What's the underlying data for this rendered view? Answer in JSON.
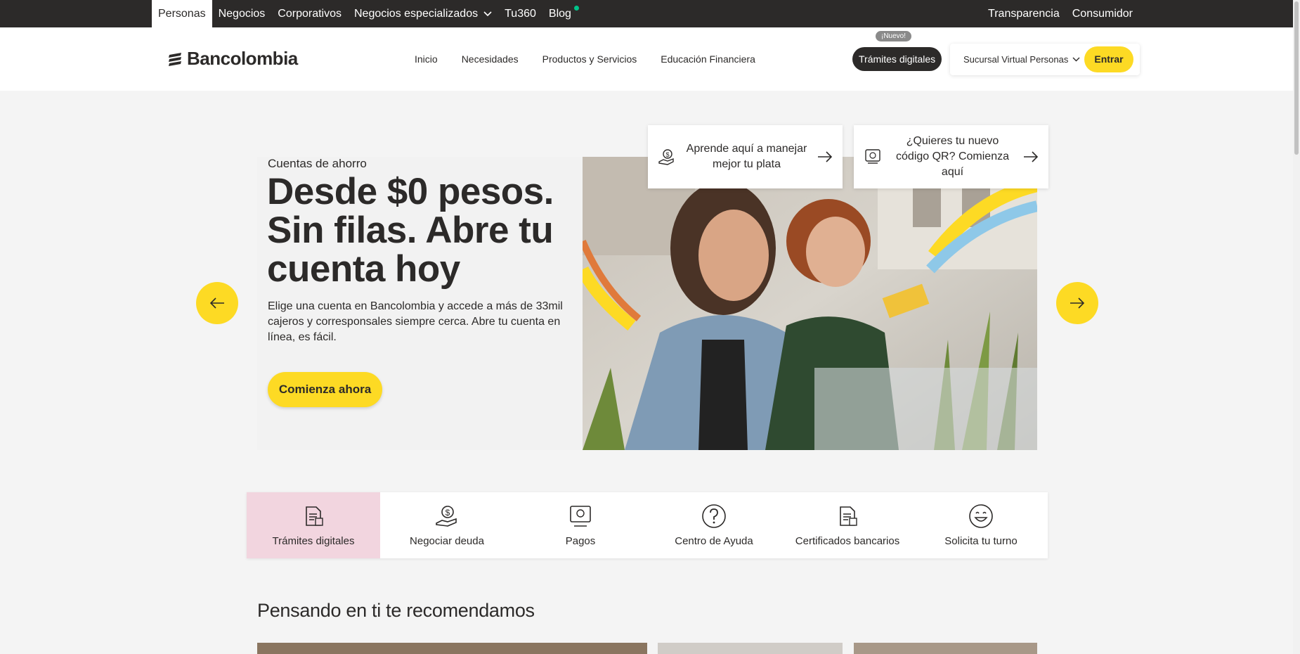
{
  "topbar": {
    "tabs": [
      "Personas",
      "Negocios",
      "Corporativos",
      "Negocios especializados",
      "Tu360",
      "Blog"
    ],
    "right_links": [
      "Transparencia",
      "Consumidor"
    ]
  },
  "header": {
    "logo_text": "Bancolombia",
    "nav": [
      "Inicio",
      "Necesidades",
      "Productos y Servicios",
      "Educación Financiera"
    ],
    "badge_new": "¡Nuevo!",
    "tramites_label": "Trámites digitales",
    "sucursal_label": "Sucursal Virtual Personas",
    "entrar_label": "Entrar"
  },
  "hero": {
    "overline": "Cuentas de ahorro",
    "title": "Desde $0 pesos. Sin filas. Abre tu cuenta hoy",
    "description": "Elige una cuenta en Bancolombia y accede a más de 33mil cajeros y corresponsales siempre cerca. Abre tu cuenta en línea, es fácil.",
    "cta": "Comienza ahora"
  },
  "quick_cards": [
    {
      "text": "Aprende aquí a manejar mejor tu plata",
      "icon": "money-hand-icon"
    },
    {
      "text": "¿Quieres tu nuevo código QR? Comienza aquí",
      "icon": "qr-payment-icon"
    }
  ],
  "quick_links": [
    {
      "label": "Trámites digitales",
      "icon": "document-icon"
    },
    {
      "label": "Negociar deuda",
      "icon": "money-hand-icon"
    },
    {
      "label": "Pagos",
      "icon": "payment-icon"
    },
    {
      "label": "Centro de Ayuda",
      "icon": "question-icon"
    },
    {
      "label": "Certificados bancarios",
      "icon": "certificate-icon"
    },
    {
      "label": "Solicita tu turno",
      "icon": "smile-icon"
    }
  ],
  "recommendations": {
    "title": "Pensando en ti te recomendamos"
  },
  "colors": {
    "brand_yellow": "#fdda24",
    "dark": "#2c2a29",
    "active_pink": "#f2d5df",
    "accent_green": "#00c389"
  }
}
